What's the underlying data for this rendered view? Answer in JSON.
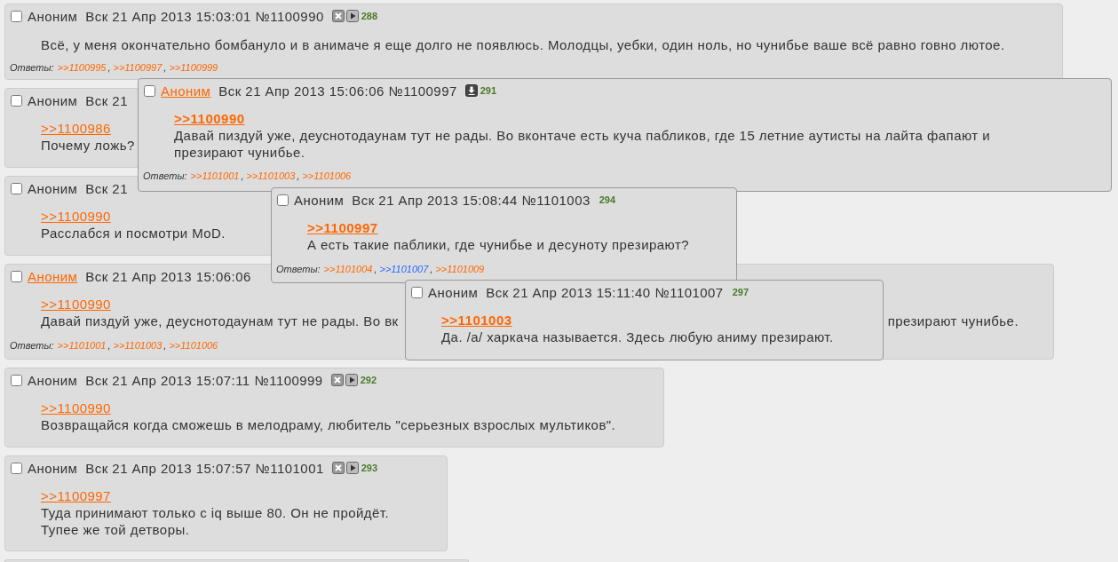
{
  "posts": [
    {
      "kind": "full",
      "checked": false,
      "author": {
        "text": "Аноним",
        "linked": false
      },
      "date": "Вск 21 Апр 2013 15:03:01",
      "number": "№1100990",
      "icons": [
        {
          "kind": "hide"
        },
        {
          "kind": "play"
        }
      ],
      "count": "288",
      "lines": [
        {
          "text": "Всё, у меня окончательно бомбануло и в анимаче я еще долго не появлюсь. Молодцы, уебки, один ноль, но чунибье ваше всё равно говно лютое."
        }
      ],
      "replies_label": "Ответы:",
      "replies": [
        {
          "text": ">>1100995",
          "separator": ","
        },
        {
          "text": ">>1100997",
          "separator": ","
        },
        {
          "text": ">>1100999"
        }
      ]
    },
    {
      "kind": "full",
      "checked": false,
      "author": {
        "text": "Аноним",
        "linked": false
      },
      "date": "Вск 21",
      "backlink": ">>1100986",
      "lines": [
        {
          "text": "Почему ложь?"
        }
      ]
    },
    {
      "kind": "full",
      "checked": false,
      "author": {
        "text": "Аноним",
        "linked": false
      },
      "date": "Вск 21",
      "backlink": ">>1100990",
      "lines": [
        {
          "text": "Расслабся и посмотри MoD."
        }
      ]
    },
    {
      "kind": "full",
      "checked": false,
      "author": {
        "text": "Аноним",
        "linked": true
      },
      "date": "Вск 21 Апр 2013 15:06:06",
      "backlink": ">>1100990",
      "lines": [
        {
          "text": "Давай пиздуй уже, деуснотодаунам тут не рады. Во вк",
          "text_right": "презирают чунибье."
        }
      ],
      "replies_label": "Ответы:",
      "replies": [
        {
          "text": ">>1101001",
          "separator": ","
        },
        {
          "text": ">>1101003",
          "separator": ","
        },
        {
          "text": ">>1101006"
        }
      ]
    },
    {
      "kind": "full",
      "checked": false,
      "author": {
        "text": "Аноним",
        "linked": false
      },
      "date": "Вск 21 Апр 2013 15:07:11",
      "number": "№1100999",
      "icons": [
        {
          "kind": "hide"
        },
        {
          "kind": "play"
        }
      ],
      "count": "292",
      "backlink": ">>1100990",
      "lines": [
        {
          "text": "Возвращайся когда сможешь в мелодраму, любитель \"серьезных взрослых мультиков\"."
        }
      ]
    },
    {
      "kind": "full",
      "checked": false,
      "author": {
        "text": "Аноним",
        "linked": false
      },
      "date": "Вск 21 Апр 2013 15:07:57",
      "number": "№1101001",
      "icons": [
        {
          "kind": "hide"
        },
        {
          "kind": "play"
        }
      ],
      "count": "293",
      "backlink": ">>1100997",
      "lines": [
        {
          "text": "Туда принимают только с iq выше 80. Он не пройдёт."
        },
        {
          "text": "Тупее же той детворы."
        }
      ]
    },
    {
      "kind": "partial"
    }
  ],
  "popups": [
    {
      "checked": false,
      "author": {
        "text": "Аноним",
        "linked": true
      },
      "date": "Вск 21 Апр 2013 15:06:06",
      "number": "№1100997",
      "icons": [
        {
          "kind": "download"
        }
      ],
      "count": "291",
      "backlink": ">>1100990",
      "lines": [
        {
          "text": "Давай пиздуй уже, деуснотодаунам тут не рады. Во вконтаче есть куча пабликов, где 15 летние аутисты на лайта фапают и презирают чунибье."
        }
      ],
      "replies_label": "Ответы:",
      "replies": [
        {
          "text": ">>1101001",
          "separator": ","
        },
        {
          "text": ">>1101003",
          "separator": ","
        },
        {
          "text": ">>1101006"
        }
      ]
    },
    {
      "checked": false,
      "author": {
        "text": "Аноним",
        "linked": false
      },
      "date": "Вск 21 Апр 2013 15:08:44",
      "number": "№1101003",
      "count": "294",
      "backlink": ">>1100997",
      "lines": [
        {
          "text": "А есть такие паблики, где чунибье и десуноту презирают?"
        }
      ],
      "replies_label": "Ответы:",
      "replies": [
        {
          "text": ">>1101004",
          "separator": ",",
          "color": "#ff6600"
        },
        {
          "text": ">>1101007",
          "separator": ",",
          "color": "#2266ff"
        },
        {
          "text": ">>1101009",
          "color": "#ff6600"
        }
      ]
    },
    {
      "checked": false,
      "author": {
        "text": "Аноним",
        "linked": false
      },
      "date": "Вск 21 Апр 2013 15:11:40",
      "number": "№1101007",
      "count": "297",
      "backlink": ">>1101003",
      "lines": [
        {
          "text": "Да. /а/ харкача называется. Здесь любую аниму презирают."
        }
      ]
    }
  ]
}
